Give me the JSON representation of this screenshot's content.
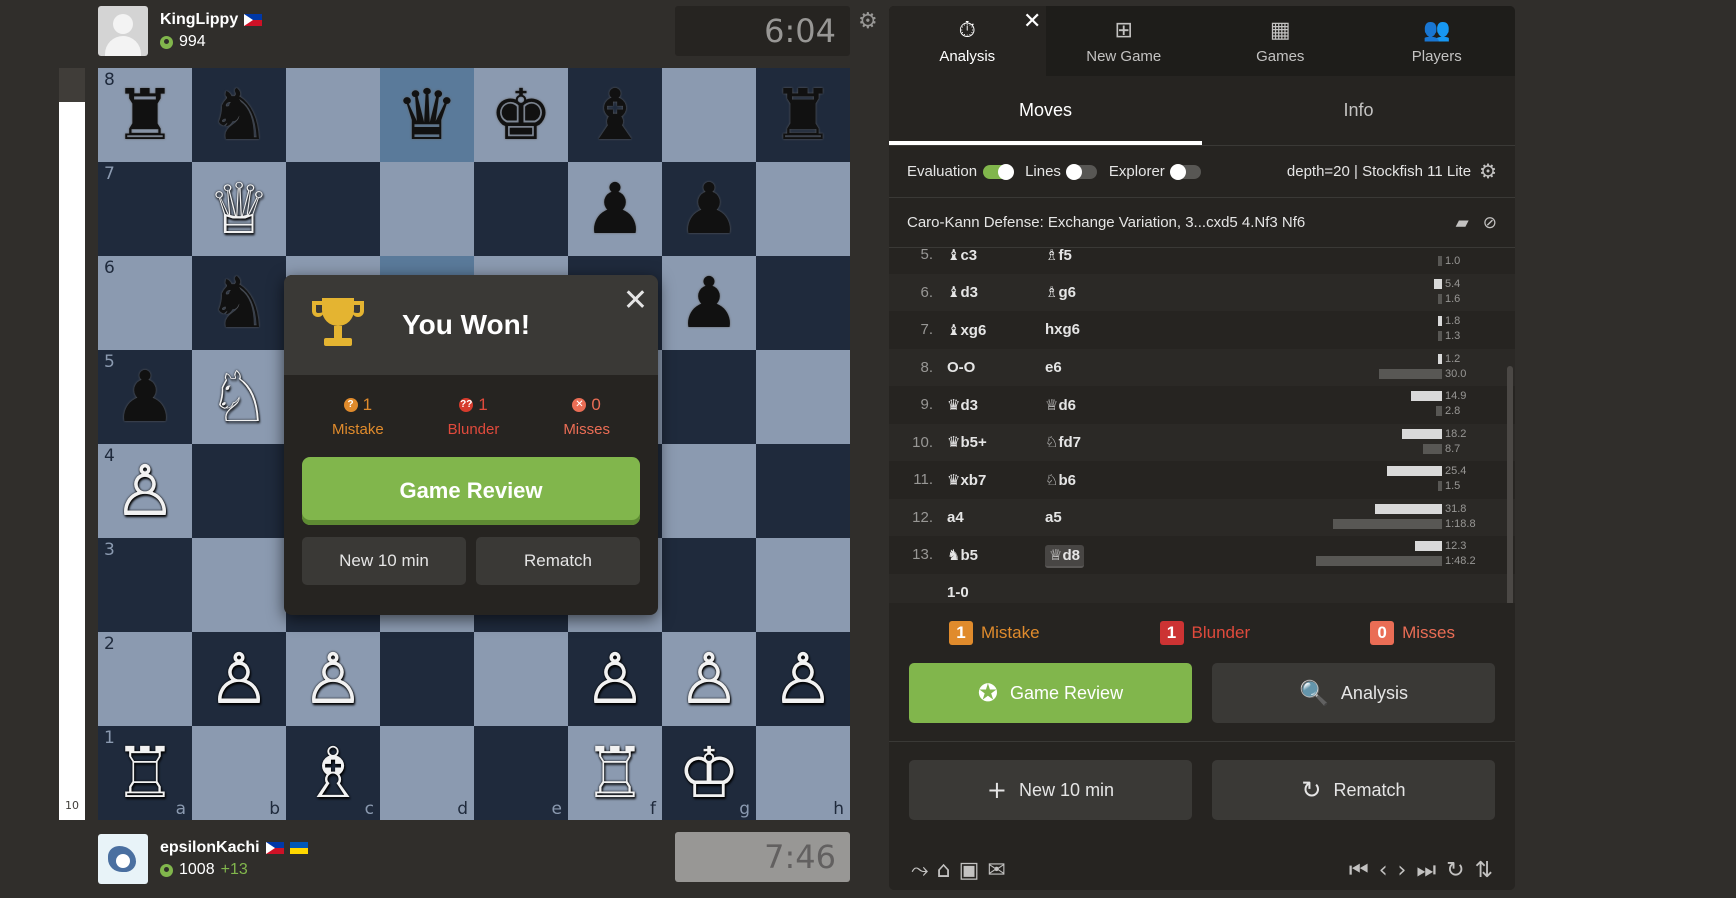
{
  "eval_bar": {
    "label": "10",
    "black_fraction": 0.045
  },
  "top_player": {
    "name": "KingLippy",
    "rating": "994",
    "clock": "6:04"
  },
  "bottom_player": {
    "name": "epsilonKachi",
    "rating": "1008",
    "rating_change": "+13",
    "clock": "7:46"
  },
  "board": {
    "ranks": [
      "8",
      "7",
      "6",
      "5",
      "4",
      "3",
      "2",
      "1"
    ],
    "files": [
      "a",
      "b",
      "c",
      "d",
      "e",
      "f",
      "g",
      "h"
    ],
    "position": [
      [
        "bR",
        "bN",
        "",
        "bQ",
        "bK",
        "bB",
        "",
        "bR"
      ],
      [
        "",
        "wQ",
        "",
        "",
        "",
        "bP",
        "bP",
        ""
      ],
      [
        "",
        "bN",
        "",
        "",
        "",
        "",
        "bP",
        ""
      ],
      [
        "bP",
        "wN",
        "",
        "",
        "",
        "",
        "",
        ""
      ],
      [
        "wP",
        "",
        "",
        "",
        "",
        "",
        "",
        ""
      ],
      [
        "",
        "",
        "",
        "",
        "",
        "",
        "",
        ""
      ],
      [
        "",
        "wP",
        "wP",
        "",
        "",
        "wP",
        "wP",
        "wP"
      ],
      [
        "wR",
        "",
        "wB",
        "",
        "",
        "wR",
        "wK",
        ""
      ]
    ],
    "highlighted": [
      "d8",
      "d6"
    ]
  },
  "modal": {
    "title": "You Won!",
    "mistake_count": "1",
    "mistake_label": "Mistake",
    "blunder_count": "1",
    "blunder_label": "Blunder",
    "miss_count": "0",
    "miss_label": "Misses",
    "review_label": "Game Review",
    "new_game_label": "New 10 min",
    "rematch_label": "Rematch"
  },
  "panel": {
    "tabs": [
      {
        "label": "Analysis",
        "icon": "stopwatch-icon"
      },
      {
        "label": "New Game",
        "icon": "plus-square-icon"
      },
      {
        "label": "Games",
        "icon": "checkerboard-icon"
      },
      {
        "label": "Players",
        "icon": "players-icon"
      }
    ],
    "subtabs": [
      "Moves",
      "Info"
    ],
    "settings": {
      "evaluation": "Evaluation",
      "lines": "Lines",
      "explorer": "Explorer",
      "engine": "depth=20  |  Stockfish 11 Lite"
    },
    "opening": "Caro-Kann Defense: Exchange Variation, 3...cxd5 4.Nf3 Nf6",
    "moves": [
      {
        "num": "5.",
        "white": "♝c3",
        "black": "♗f5",
        "wt": "",
        "bt": "1.0",
        "wbar": 0,
        "bbar": 2
      },
      {
        "num": "6.",
        "white": "♝d3",
        "black": "♗g6",
        "wt": "5.4",
        "bt": "1.6",
        "wbar": 4,
        "bbar": 2
      },
      {
        "num": "7.",
        "white": "♝xg6",
        "black": "hxg6",
        "wt": "1.8",
        "bt": "1.3",
        "wbar": 2,
        "bbar": 2
      },
      {
        "num": "8.",
        "white": "O-O",
        "black": "e6",
        "wt": "1.2",
        "bt": "30.0",
        "wbar": 2,
        "bbar": 30
      },
      {
        "num": "9.",
        "white": "♛d3",
        "black": "♕d6",
        "wt": "14.9",
        "bt": "2.8",
        "wbar": 15,
        "bbar": 3
      },
      {
        "num": "10.",
        "white": "♛b5+",
        "black": "♘fd7",
        "wt": "18.2",
        "bt": "8.7",
        "wbar": 19,
        "bbar": 9
      },
      {
        "num": "11.",
        "white": "♛xb7",
        "black": "♘b6",
        "wt": "25.4",
        "bt": "1.5",
        "wbar": 26,
        "bbar": 2
      },
      {
        "num": "12.",
        "white": "a4",
        "black": "a5",
        "wt": "31.8",
        "bt": "1:18.8",
        "wbar": 32,
        "bbar": 52
      },
      {
        "num": "13.",
        "white": "♞b5",
        "black": "♕d8",
        "wt": "12.3",
        "bt": "1:48.2",
        "wbar": 13,
        "bbar": 60
      }
    ],
    "result": "1-0",
    "summary": {
      "mistake_count": "1",
      "mistake_label": "Mistake",
      "blunder_count": "1",
      "blunder_label": "Blunder",
      "miss_count": "0",
      "miss_label": "Misses"
    },
    "review_label": "Game Review",
    "analysis_label": "Analysis",
    "new_game_label": "New 10 min",
    "rematch_label": "Rematch"
  },
  "colors": {
    "green": "#81b64c",
    "mistake": "#e08b2c",
    "blunder": "#d63b2c",
    "miss": "#ea6d55"
  }
}
